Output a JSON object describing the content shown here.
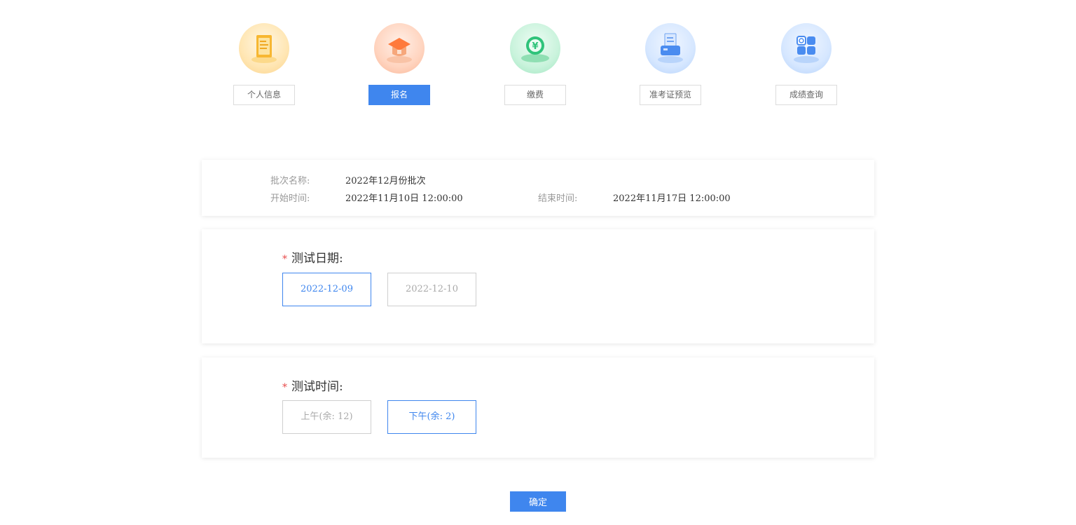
{
  "steps": [
    {
      "label": "个人信息",
      "icon": "document-icon"
    },
    {
      "label": "报名",
      "icon": "graduation-cap-icon"
    },
    {
      "label": "缴费",
      "icon": "yuan-coin-icon"
    },
    {
      "label": "准考证预览",
      "icon": "ticket-printer-icon"
    },
    {
      "label": "成绩查询",
      "icon": "grid-search-icon"
    }
  ],
  "active_step": "报名",
  "batch": {
    "name_label": "批次名称:",
    "name_value": "2022年12月份批次",
    "start_label": "开始时间:",
    "start_value": "2022年11月10日 12:00:00",
    "end_label": "结束时间:",
    "end_value": "2022年11月17日 12:00:00"
  },
  "test_date": {
    "required_mark": "*",
    "title": "测试日期:",
    "options": [
      "2022-12-09",
      "2022-12-10"
    ],
    "selected": "2022-12-09"
  },
  "test_time": {
    "required_mark": "*",
    "title": "测试时间:",
    "options": [
      "上午(余: 12)",
      "下午(余: 2)"
    ],
    "selected": "下午(余: 2)"
  },
  "confirm_label": "确定",
  "colors": {
    "accent": "#3f86ee",
    "required": "#e84c4c"
  }
}
